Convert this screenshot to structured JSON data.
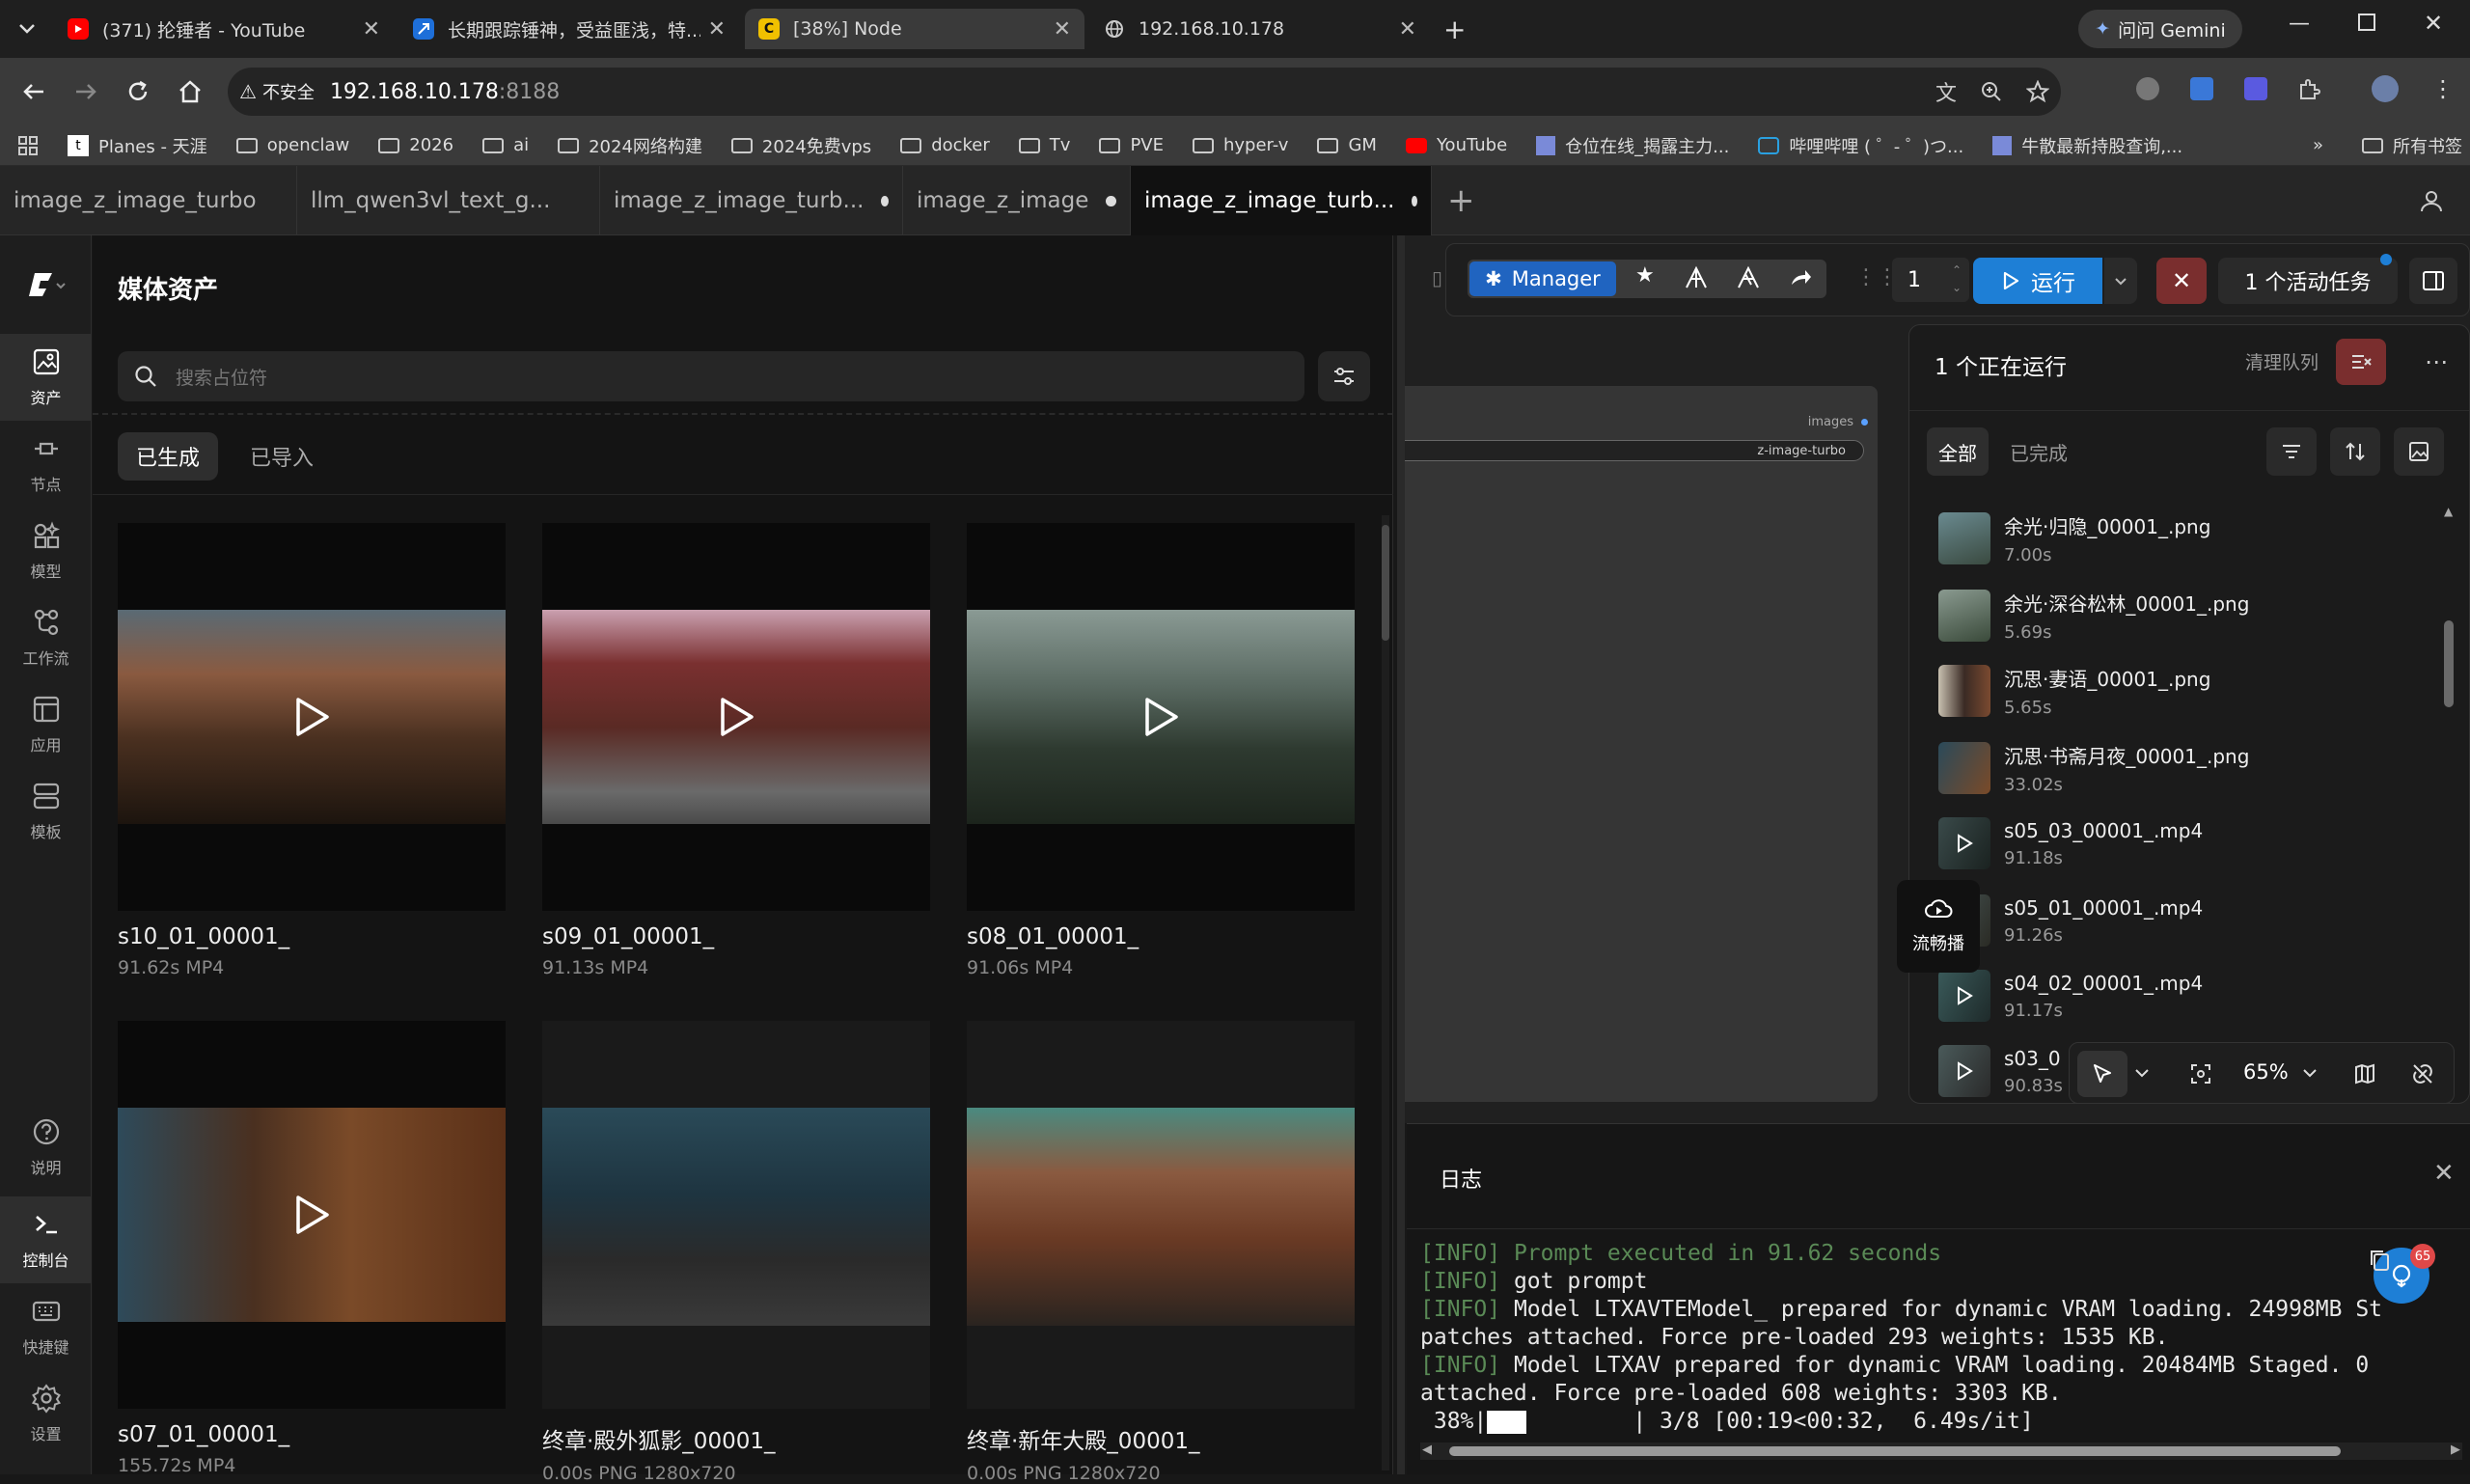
{
  "browser": {
    "tabs": [
      {
        "title": "(371) 抡锤者 - YouTube",
        "icon": "youtube-icon",
        "color": "#ff0000"
      },
      {
        "title": "长期跟踪锤神，受益匪浅，特...",
        "icon": "blue-app-icon",
        "color": "#1e6fd9"
      },
      {
        "title": "[38%] Node",
        "icon": "comfy-icon",
        "color": "#f0c000"
      },
      {
        "title": "192.168.10.178",
        "icon": "globe-icon",
        "color": "#bbbbbb"
      }
    ],
    "new_tab": "+",
    "gemini_label": "问问 Gemini",
    "security_label": "不安全",
    "url_host": "192.168.10.178",
    "url_port": ":8188",
    "bookmarks": [
      "Planes - 天涯",
      "openclaw",
      "2026",
      "ai",
      "2024网络构建",
      "2024免费vps",
      "docker",
      "Tv",
      "PVE",
      "hyper-v",
      "GM",
      "YouTube",
      "仓位在线_揭露主力...",
      "哔哩哔哩 ( ゜- ゜)つ...",
      "牛散最新持股查询,..."
    ],
    "all_bookmarks": "所有书签"
  },
  "app": {
    "tabs": [
      {
        "label": "image_z_image_turbo",
        "dirty": false
      },
      {
        "label": "llm_qwen3vl_text_g...",
        "dirty": false
      },
      {
        "label": "image_z_image_turb...",
        "dirty": true
      },
      {
        "label": "image_z_image",
        "dirty": true
      },
      {
        "label": "image_z_image_turb...",
        "dirty": true,
        "active": true
      }
    ],
    "rail": [
      {
        "label": "资产",
        "icon": "assets-icon",
        "active": true
      },
      {
        "label": "节点",
        "icon": "node-icon"
      },
      {
        "label": "模型",
        "icon": "model-icon"
      },
      {
        "label": "工作流",
        "icon": "workflow-icon"
      },
      {
        "label": "应用",
        "icon": "app-icon"
      },
      {
        "label": "模板",
        "icon": "template-icon"
      }
    ],
    "rail_bottom": [
      {
        "label": "说明",
        "icon": "help-icon"
      },
      {
        "label": "控制台",
        "icon": "console-icon",
        "active": true
      },
      {
        "label": "快捷键",
        "icon": "keyboard-icon"
      },
      {
        "label": "设置",
        "icon": "gear-icon"
      }
    ],
    "assets": {
      "title": "媒体资产",
      "search_placeholder": "搜索占位符",
      "tab_generated": "已生成",
      "tab_imported": "已导入",
      "cards": [
        {
          "name": "s10_01_00001_",
          "meta": "91.62s  MP4",
          "video": true
        },
        {
          "name": "s09_01_00001_",
          "meta": "91.13s  MP4",
          "video": true
        },
        {
          "name": "s08_01_00001_",
          "meta": "91.06s  MP4",
          "video": true
        },
        {
          "name": "s07_01_00001_",
          "meta": "155.72s  MP4",
          "video": true
        },
        {
          "name": "终章·殿外狐影_00001_",
          "meta": "0.00s  PNG 1280x720",
          "video": false
        },
        {
          "name": "终章·新年大殿_00001_",
          "meta": "0.00s  PNG 1280x720",
          "video": false
        }
      ]
    },
    "actionbar": {
      "manager": "Manager",
      "batch": "1",
      "run": "运行",
      "active_tasks": "1 个活动任务"
    },
    "node_label_images": "images",
    "node_label_model": "z-image-turbo",
    "queue": {
      "title": "1 个正在运行",
      "clear": "清理队列",
      "filter_all": "全部",
      "filter_done": "已完成",
      "items": [
        {
          "name": "余光·归隐_00001_.png",
          "time": "7.00s",
          "video": false
        },
        {
          "name": "余光·深谷松林_00001_.png",
          "time": "5.69s",
          "video": false
        },
        {
          "name": "沉思·妻语_00001_.png",
          "time": "5.65s",
          "video": false
        },
        {
          "name": "沉思·书斋月夜_00001_.png",
          "time": "33.02s",
          "video": false
        },
        {
          "name": "s05_03_00001_.mp4",
          "time": "91.18s",
          "video": true
        },
        {
          "name": "s05_01_00001_.mp4",
          "time": "91.26s",
          "video": true
        },
        {
          "name": "s04_02_00001_.mp4",
          "time": "91.17s",
          "video": true
        },
        {
          "name": "s03_0",
          "time": "90.83s",
          "video": true
        }
      ]
    },
    "float_badge": "流畅播",
    "zoom": "65%",
    "log": {
      "title": "日志",
      "badge": "65",
      "lines": [
        {
          "tag": "[INFO]",
          "text": " Prompt executed in 91.62 seconds",
          "green": true
        },
        {
          "tag": "[INFO]",
          "text": " got prompt"
        },
        {
          "tag": "[INFO]",
          "text": " Model LTXAVTEModel_ prepared for dynamic VRAM loading. 24998MB St"
        },
        {
          "tag": "",
          "text": "patches attached. Force pre-loaded 293 weights: 1535 KB."
        },
        {
          "tag": "[INFO]",
          "text": " Model LTXAV prepared for dynamic VRAM loading. 20484MB Staged. 0"
        },
        {
          "tag": "",
          "text": "attached. Force pre-loaded 608 weights: 3303 KB."
        }
      ],
      "progress_pct": " 38%|",
      "progress_fraction": 0.38,
      "progress_rest": "      | 3/8 [00:19<00:32,  6.49s/it]"
    }
  }
}
